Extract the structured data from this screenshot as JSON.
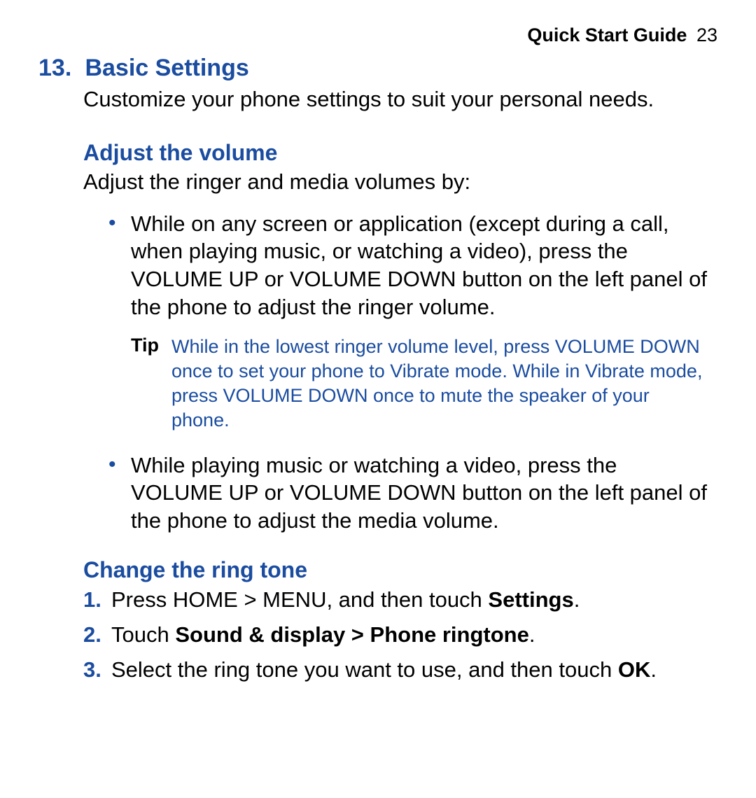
{
  "header": {
    "title": "Quick Start Guide",
    "page": "23"
  },
  "section": {
    "number": "13.",
    "title": "Basic Settings",
    "intro": "Customize your phone settings to suit your personal needs."
  },
  "volume": {
    "heading": "Adjust the volume",
    "intro": "Adjust the ringer and media volumes by:",
    "bullets": [
      "While on any screen or application (except during a call, when playing music, or watching a video), press the VOLUME UP or VOLUME DOWN button on the left panel of the phone to adjust the ringer volume.",
      "While playing music or watching a video, press the VOLUME UP or VOLUME DOWN button on the left panel of the phone to adjust the media volume."
    ],
    "tip": {
      "label": "Tip",
      "text": "While in the lowest ringer volume level, press VOLUME DOWN once to set your phone to Vibrate mode. While in Vibrate mode, press VOLUME DOWN once to mute the speaker of your phone."
    }
  },
  "ringtone": {
    "heading": "Change the ring tone",
    "steps": {
      "s1_prefix": "Press HOME > MENU, and then touch ",
      "s1_bold": "Settings",
      "s1_suffix": ".",
      "s2_prefix": "Touch ",
      "s2_bold": "Sound & display > Phone ringtone",
      "s2_suffix": ".",
      "s3_prefix": "Select the ring tone you want to use, and then touch ",
      "s3_bold": "OK",
      "s3_suffix": "."
    }
  }
}
